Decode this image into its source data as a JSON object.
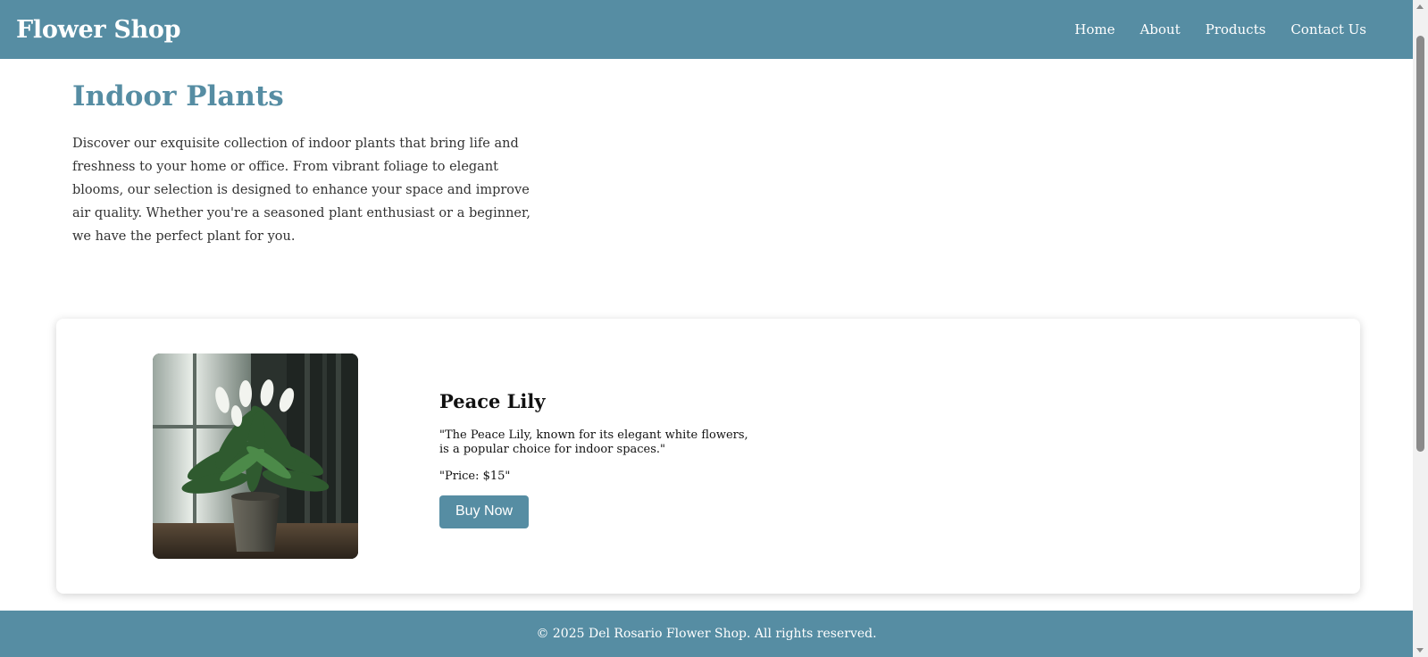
{
  "brand": "Flower Shop",
  "nav": [
    {
      "label": "Home"
    },
    {
      "label": "About"
    },
    {
      "label": "Products"
    },
    {
      "label": "Contact Us"
    }
  ],
  "intro": {
    "title": "Indoor Plants",
    "text": "Discover our exquisite collection of indoor plants that bring life and freshness to your home or office. From vibrant foliage to elegant blooms, our selection is designed to enhance your space and improve air quality. Whether you're a seasoned plant enthusiast or a beginner, we have the perfect plant for you."
  },
  "product": {
    "name": "Peace Lily",
    "description": "\"The Peace Lily, known for its elegant white flowers, is a popular choice for indoor spaces.\"",
    "price": "\"Price: $15\"",
    "buy_label": "Buy Now",
    "image_icon": "peace-lily-photo"
  },
  "footer": {
    "text": "© 2025 Del Rosario Flower Shop. All rights reserved."
  },
  "colors": {
    "brand": "#568da3",
    "background": "#ffffff"
  }
}
